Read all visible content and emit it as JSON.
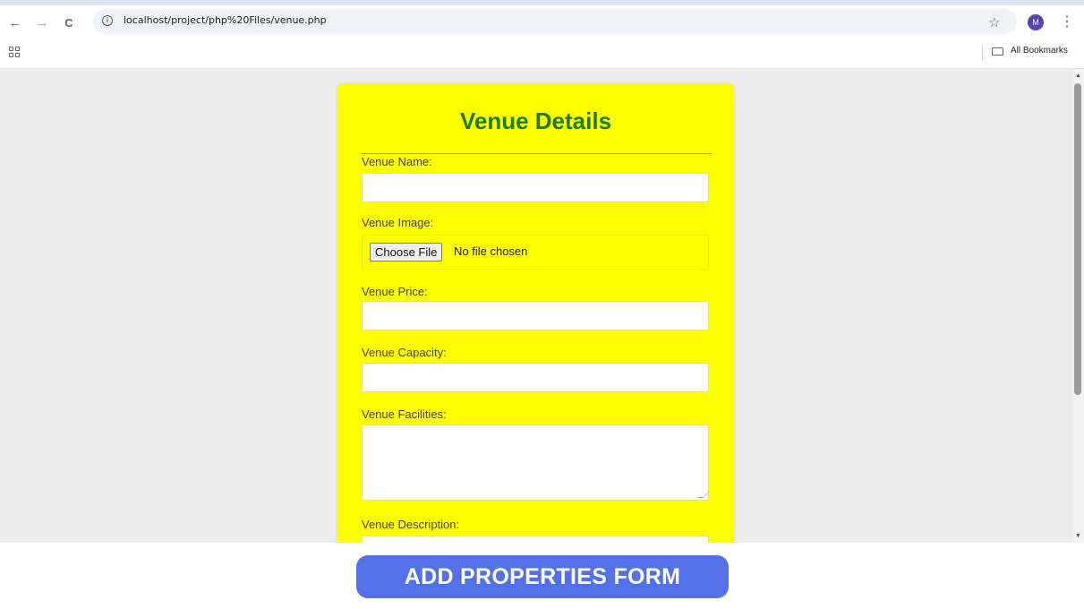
{
  "browser": {
    "url": "localhost/project/php%20Files/venue.php",
    "avatar_letter": "M",
    "bookmarks_label": "All Bookmarks",
    "back_glyph": "←",
    "forward_glyph": "→",
    "reload_glyph": "C",
    "star_glyph": "☆",
    "menu_glyph": "⋮",
    "info_glyph": "i"
  },
  "form": {
    "title": "Venue Details",
    "venue_name_label": "Venue Name:",
    "venue_image_label": "Venue Image:",
    "choose_file_label": "Choose File",
    "no_file_text": "No file chosen",
    "venue_price_label": "Venue Price:",
    "venue_capacity_label": "Venue Capacity:",
    "venue_facilities_label": "Venue Facilities:",
    "venue_description_label": "Venue Description:"
  },
  "caption": "ADD PROPERTIES FORM",
  "colors": {
    "card_background": "#ffff00",
    "title_color": "#1d7d0c",
    "caption_background": "#5271e8",
    "page_background": "#ededed"
  },
  "icons": [
    "back-arrow-icon",
    "forward-arrow-icon",
    "reload-icon",
    "info-icon",
    "star-icon",
    "kebab-menu-icon",
    "apps-grid-icon",
    "folder-icon"
  ]
}
